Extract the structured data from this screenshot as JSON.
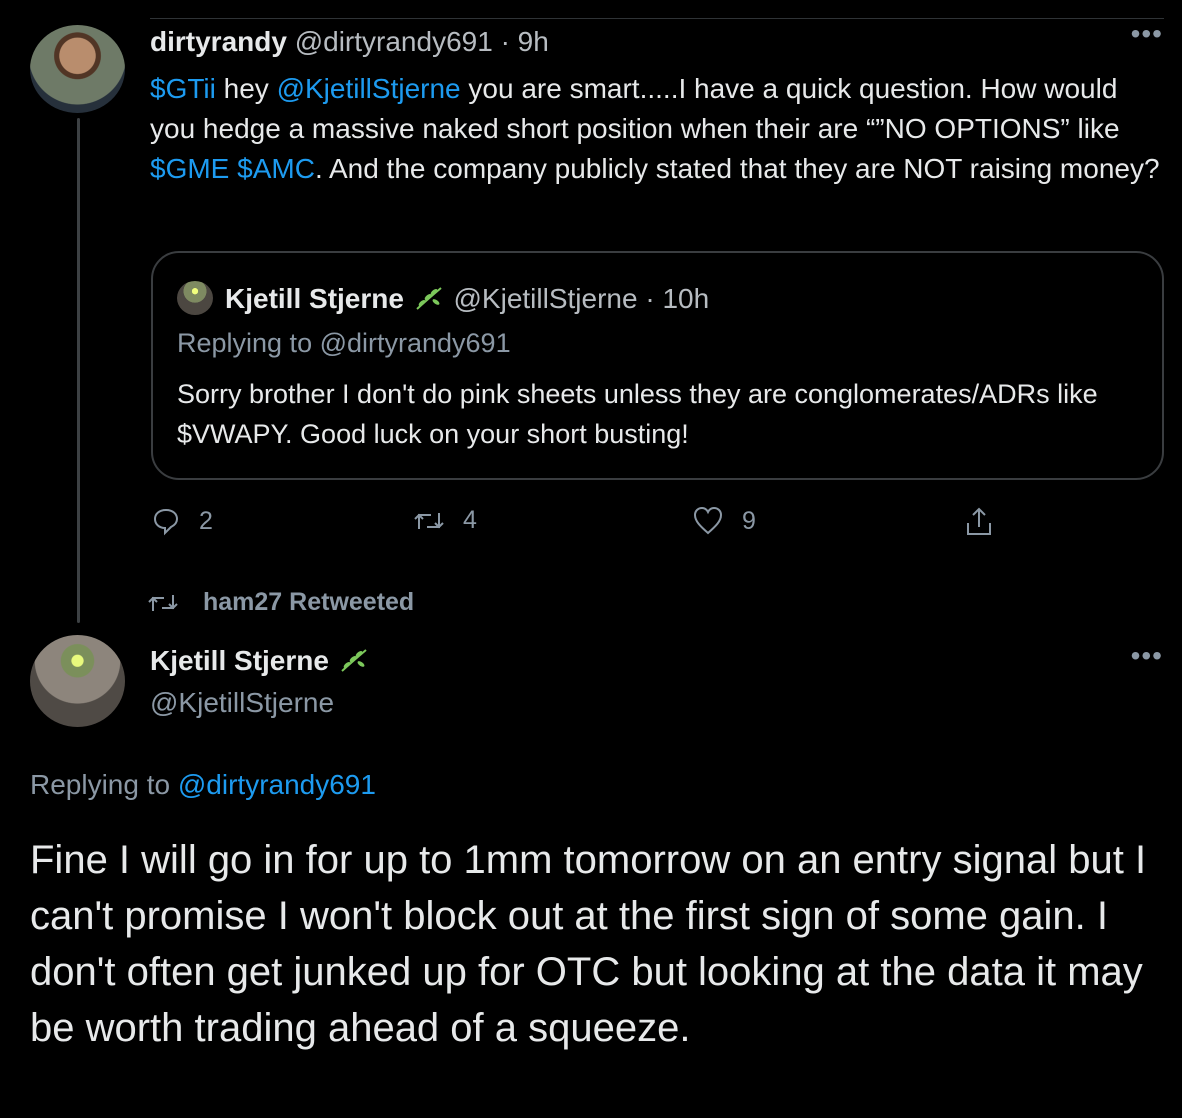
{
  "tweet1": {
    "display_name": "dirtyrandy",
    "handle": "@dirtyrandy691",
    "time": "· 9h",
    "text_parts": [
      {
        "text": "$GTii",
        "link": true
      },
      {
        "text": " hey ",
        "link": false
      },
      {
        "text": "@KjetillStjerne",
        "link": true
      },
      {
        "text": " you are smart.....I have a quick question.   How would you hedge a massive naked short position when their are “”NO OPTIONS” like ",
        "link": false
      },
      {
        "text": "$GME",
        "link": true
      },
      {
        "text": " ",
        "link": false
      },
      {
        "text": "$AMC",
        "link": true
      },
      {
        "text": ".   And the company publicly stated that they are NOT raising money?",
        "link": false
      }
    ]
  },
  "quote": {
    "display_name": "Kjetill Stjerne",
    "emoji_icon": "herb-icon",
    "handle": "@KjetillStjerne",
    "time": "· 10h",
    "replying": "Replying to @dirtyrandy691",
    "text": "Sorry brother I don't do pink sheets unless they are conglomerates/ADRs like $VWAPY. Good luck on your short busting!"
  },
  "actions": {
    "reply_count": "2",
    "retweet_count": "4",
    "like_count": "9"
  },
  "retweeted_by": "ham27 Retweeted",
  "tweet2": {
    "display_name": "Kjetill Stjerne",
    "emoji_icon": "herb-icon",
    "handle": "@KjetillStjerne",
    "replying_prefix": "Replying to ",
    "replying_link": "@dirtyrandy691",
    "text": "Fine I will go in for up to 1mm tomorrow on an entry signal but I can't promise I won't block out at the first sign of some gain. I don't often get junked up for OTC but looking at the data it may be worth trading ahead of a squeeze."
  },
  "colors": {
    "background": "#000000",
    "link": "#1d9bf0",
    "secondary_text": "#8b98a5"
  }
}
